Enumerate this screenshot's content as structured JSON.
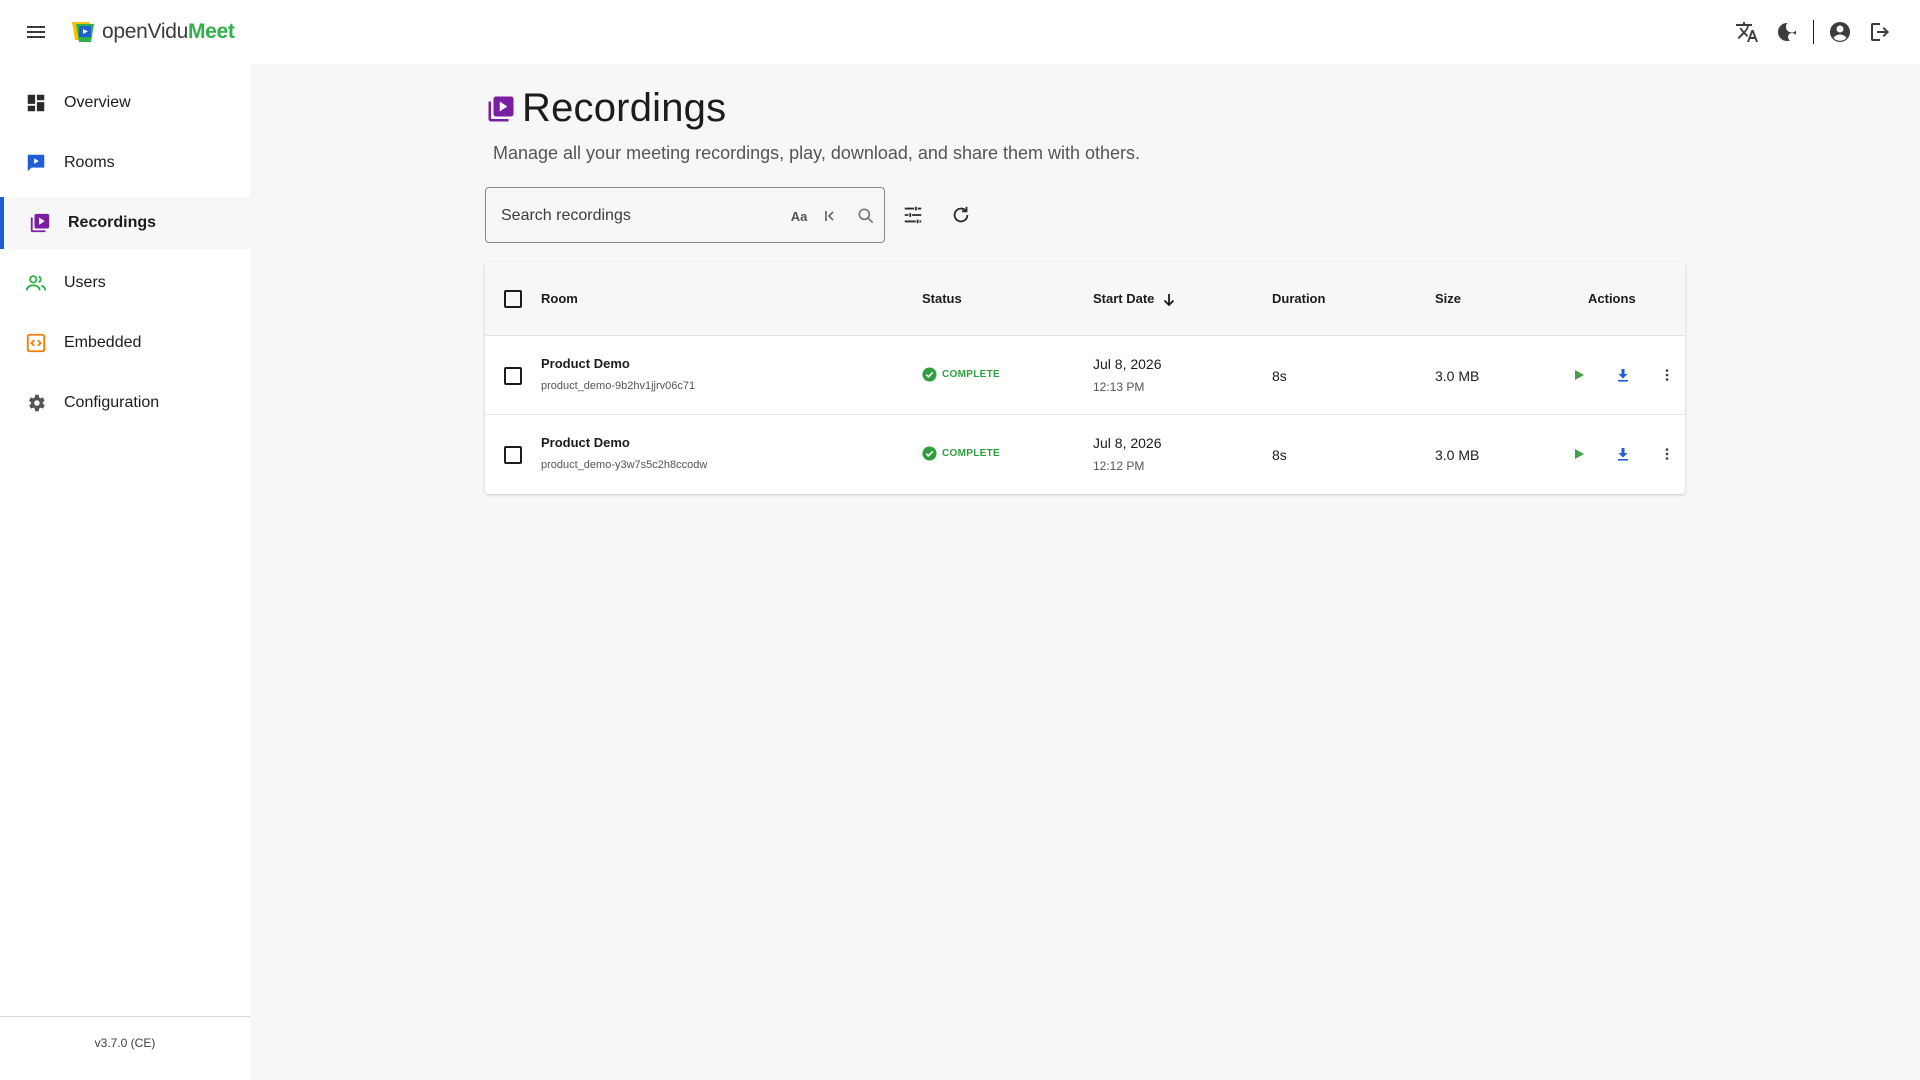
{
  "app": {
    "brand_prefix": "openVidu",
    "brand_suffix": "Meet",
    "version": "v3.7.0 (CE)"
  },
  "sidebar": {
    "items": [
      {
        "label": "Overview",
        "icon": "dashboard-icon"
      },
      {
        "label": "Rooms",
        "icon": "rooms-icon"
      },
      {
        "label": "Recordings",
        "icon": "recordings-icon",
        "active": true
      },
      {
        "label": "Users",
        "icon": "users-icon"
      },
      {
        "label": "Embedded",
        "icon": "embedded-icon"
      },
      {
        "label": "Configuration",
        "icon": "gear-icon"
      }
    ]
  },
  "page": {
    "title": "Recordings",
    "subtitle": "Manage all your meeting recordings, play, download, and share them with others."
  },
  "search": {
    "placeholder": "Search recordings",
    "case_toggle": "Aa"
  },
  "table": {
    "headers": {
      "room": "Room",
      "status": "Status",
      "start_date": "Start Date",
      "duration": "Duration",
      "size": "Size",
      "actions": "Actions"
    },
    "rows": [
      {
        "room_name": "Product Demo",
        "room_id": "product_demo-9b2hv1jjrv06c71",
        "status": "COMPLETE",
        "date": "Jul 8, 2026",
        "time": "12:13 PM",
        "duration": "8s",
        "size": "3.0 MB"
      },
      {
        "room_name": "Product Demo",
        "room_id": "product_demo-y3w7s5c2h8ccodw",
        "status": "COMPLETE",
        "date": "Jul 8, 2026",
        "time": "12:12 PM",
        "duration": "8s",
        "size": "3.0 MB"
      }
    ]
  },
  "colors": {
    "accent": "#1e5fd6",
    "recordings_purple": "#7b1fa2",
    "status_green": "#2e9e3e",
    "play_green": "#43a047",
    "download_blue": "#1e5fd6",
    "embedded_orange": "#f57c00"
  }
}
